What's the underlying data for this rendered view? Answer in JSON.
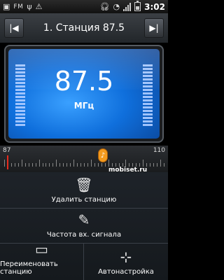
{
  "status_bar": {
    "fm_label": "FM",
    "usb_icon": "usb-icon",
    "time": "3:02"
  },
  "top_bar": {
    "prev_icon": "skip-previous-icon",
    "next_icon": "skip-next-icon",
    "station_title": "1. Станция 87.5"
  },
  "display": {
    "frequency": "87.5",
    "unit": "МГц"
  },
  "scale": {
    "min_label": "87",
    "max_label": "110",
    "watermark": "mobiset.ru"
  },
  "menu": {
    "items": [
      {
        "label": "Удалить станцию",
        "icon": "trash-icon"
      },
      {
        "label": "Частота вх. сигнала",
        "icon": "edit-icon"
      },
      {
        "label": "Переименовать станцию",
        "icon": "rename-icon"
      },
      {
        "label": "Автонастройка",
        "icon": "autotune-icon"
      }
    ]
  },
  "colors": {
    "display_blue": "#0f6fdc",
    "needle_red": "#e62b1e",
    "knob_orange": "#f39a1e"
  }
}
